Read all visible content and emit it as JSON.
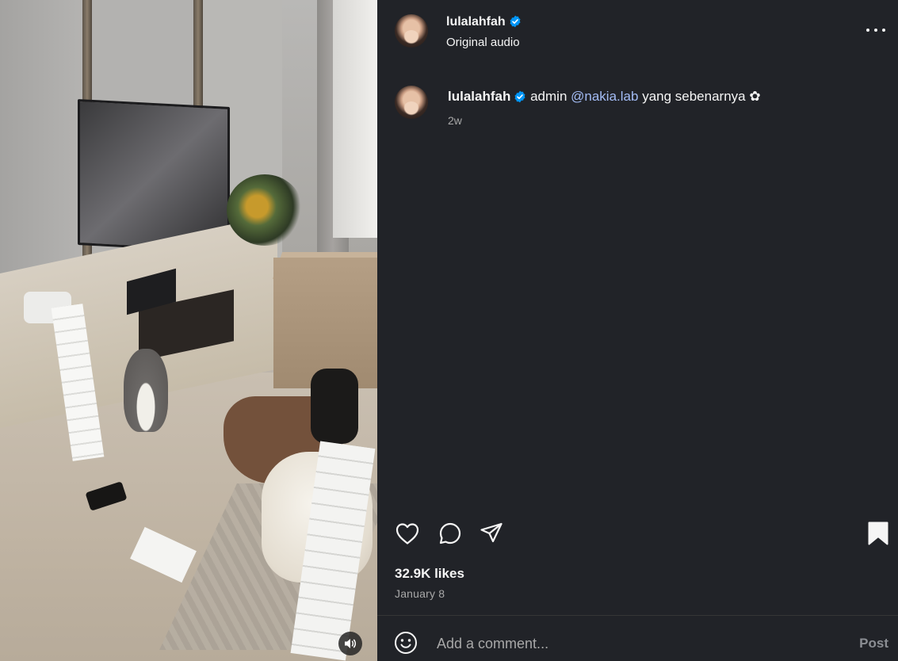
{
  "post": {
    "username": "lulalahfah",
    "audio": "Original audio",
    "caption": {
      "username": "lulalahfah",
      "text_before": "admin",
      "mention": "@nakia.lab",
      "text_after": "yang sebenarnya",
      "emoji": "✿",
      "time": "2w"
    },
    "likes": "32.9K likes",
    "date": "January 8"
  },
  "comment": {
    "placeholder": "Add a comment...",
    "post_label": "Post"
  },
  "icons": {
    "verified": "verified-badge-icon",
    "more": "more-options-icon",
    "like": "heart-icon",
    "comment": "comment-icon",
    "share": "share-icon",
    "save": "bookmark-icon",
    "emoji": "emoji-icon",
    "sound": "speaker-icon"
  },
  "colors": {
    "panel_bg": "#212328",
    "verified": "#0095f6",
    "mention": "#a3bcf5",
    "muted_text": "#a8a8a8"
  }
}
